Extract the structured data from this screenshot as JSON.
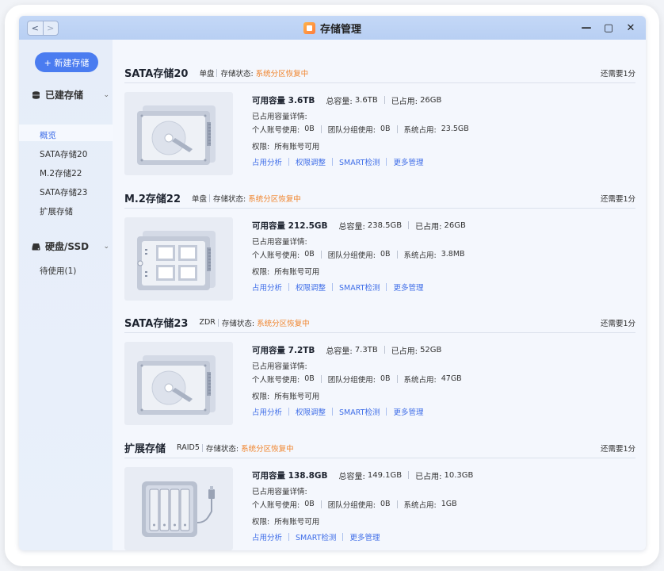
{
  "window": {
    "title": "存储管理",
    "nav_back": "<",
    "nav_forward": ">",
    "ctrl_minimize": "—",
    "ctrl_maximize": "▢",
    "ctrl_close": "✕"
  },
  "sidebar": {
    "new_button": "+ 新建存储",
    "section_built": "已建存储",
    "built_items": [
      {
        "label": "概览",
        "active": true
      },
      {
        "label": "SATA存储20"
      },
      {
        "label": "M.2存储22"
      },
      {
        "label": "SATA存储23"
      },
      {
        "label": "扩展存储"
      }
    ],
    "section_disk": "硬盘/SSD",
    "disk_items": [
      {
        "label": "待使用(1)"
      }
    ]
  },
  "labels": {
    "status_prefix": "存储状态:",
    "details": "已占用容量详情:",
    "personal": "个人账号使用:",
    "group": "团队分组使用:",
    "system": "系统占用:",
    "perm": "权限:",
    "total": "总容量:",
    "used": "已占用:",
    "available": "可用容量"
  },
  "groups": [
    {
      "name": "SATA存储20",
      "type": "单盘",
      "status": "系统分区恢复中",
      "remain": "还需要1分",
      "available": "3.6TB",
      "total": "3.6TB",
      "used": "26GB",
      "personal": "0B",
      "group": "0B",
      "system": "23.5GB",
      "perm": "所有账号可用",
      "icon": "hdd-icon",
      "actions": [
        "占用分析",
        "权限调整",
        "SMART检测",
        "更多管理"
      ]
    },
    {
      "name": "M.2存储22",
      "type": "单盘",
      "status": "系统分区恢复中",
      "remain": "还需要1分",
      "available": "212.5GB",
      "total": "238.5GB",
      "used": "26GB",
      "personal": "0B",
      "group": "0B",
      "system": "3.8MB",
      "perm": "所有账号可用",
      "icon": "ssd-icon",
      "actions": [
        "占用分析",
        "权限调整",
        "SMART检测",
        "更多管理"
      ]
    },
    {
      "name": "SATA存储23",
      "type": "ZDR",
      "status": "系统分区恢复中",
      "remain": "还需要1分",
      "available": "7.2TB",
      "total": "7.3TB",
      "used": "52GB",
      "personal": "0B",
      "group": "0B",
      "system": "47GB",
      "perm": "所有账号可用",
      "icon": "hdd-icon",
      "actions": [
        "占用分析",
        "权限调整",
        "SMART检测",
        "更多管理"
      ]
    },
    {
      "name": "扩展存储",
      "type": "RAID5",
      "status": "系统分区恢复中",
      "remain": "还需要1分",
      "available": "138.8GB",
      "total": "149.1GB",
      "used": "10.3GB",
      "personal": "0B",
      "group": "0B",
      "system": "1GB",
      "perm": "所有账号可用",
      "icon": "external-storage-icon",
      "actions": [
        "占用分析",
        "SMART检测",
        "更多管理"
      ]
    }
  ]
}
